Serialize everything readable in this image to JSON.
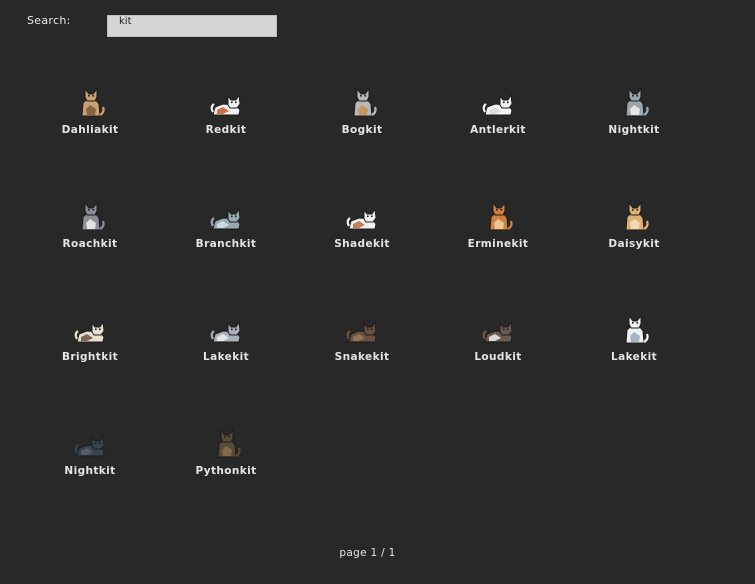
{
  "search": {
    "label": "Search:",
    "value": "kit"
  },
  "cats": [
    {
      "name": "Dahliakit",
      "sprite": "cat-sitting-icon",
      "body": "#c9a070",
      "accent": "#7a5a3a"
    },
    {
      "name": "Redkit",
      "sprite": "cat-lying-icon",
      "body": "#f2f2f2",
      "accent": "#c85a2a"
    },
    {
      "name": "Bogkit",
      "sprite": "cat-sitting-icon",
      "body": "#b8b8b8",
      "accent": "#c79050"
    },
    {
      "name": "Antlerkit",
      "sprite": "cat-lying-icon",
      "body": "#f4f4f4",
      "accent": "#d9d9d9"
    },
    {
      "name": "Nightkit",
      "sprite": "cat-sitting-icon",
      "body": "#9aa6ae",
      "accent": "#f0f0f0"
    },
    {
      "name": "Roachkit",
      "sprite": "cat-sitting-icon",
      "body": "#8a8e96",
      "accent": "#f0f0f0"
    },
    {
      "name": "Branchkit",
      "sprite": "cat-lying-icon",
      "body": "#9aa8b0",
      "accent": "#d8e0e4"
    },
    {
      "name": "Shadekit",
      "sprite": "cat-lying-icon",
      "body": "#f2f2f2",
      "accent": "#c06a30"
    },
    {
      "name": "Erminekit",
      "sprite": "cat-sitting-icon",
      "body": "#d08040",
      "accent": "#f0d0a8"
    },
    {
      "name": "Daisykit",
      "sprite": "cat-sitting-icon",
      "body": "#e0b070",
      "accent": "#f4e0c0"
    },
    {
      "name": "Brightkit",
      "sprite": "cat-lying-icon",
      "body": "#e8e0d0",
      "accent": "#6a5040"
    },
    {
      "name": "Lakekit",
      "sprite": "cat-lying-icon",
      "body": "#a8b0b8",
      "accent": "#f0f0f0"
    },
    {
      "name": "Snakekit",
      "sprite": "cat-lying-icon",
      "body": "#6a5242",
      "accent": "#a07858"
    },
    {
      "name": "Loudkit",
      "sprite": "cat-lying-icon",
      "body": "#6a5a50",
      "accent": "#f0f0f0"
    },
    {
      "name": "Lakekit",
      "sprite": "cat-sitting-icon",
      "body": "#f0f0f0",
      "accent": "#9aa8b8"
    },
    {
      "name": "Nightkit",
      "sprite": "cat-lying-icon",
      "body": "#3a4450",
      "accent": "#5a6470"
    },
    {
      "name": "Pythonkit",
      "sprite": "cat-sitting-icon",
      "body": "#5a4a38",
      "accent": "#8a7050"
    }
  ],
  "pagination": {
    "text": "page 1 / 1"
  }
}
